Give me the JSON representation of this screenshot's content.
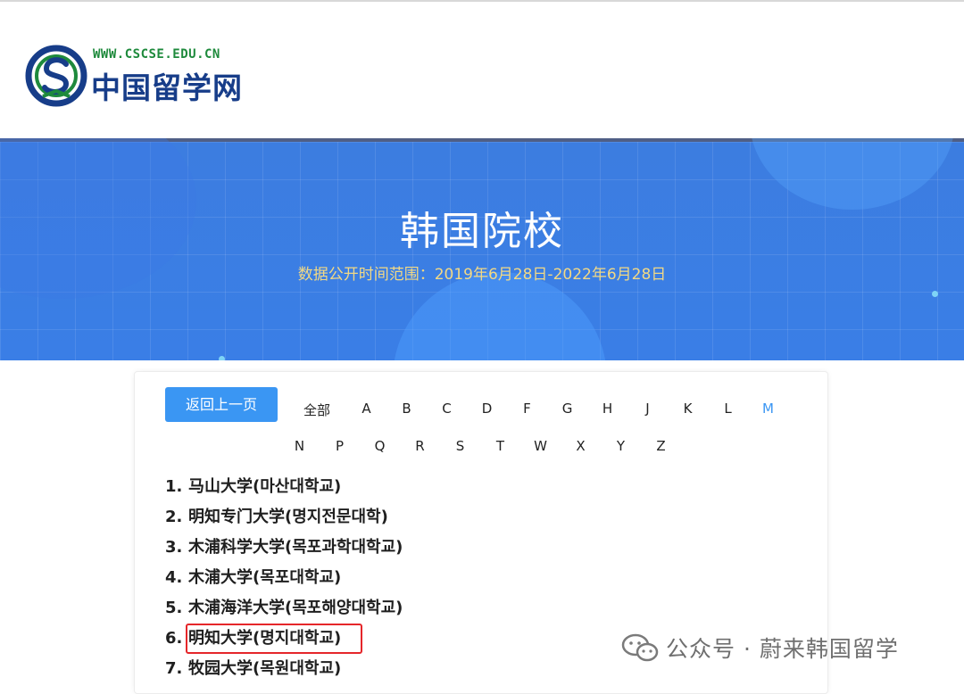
{
  "header": {
    "logo_url": "WWW.CSCSE.EDU.CN",
    "logo_name": "中国留学网"
  },
  "banner": {
    "title": "韩国院校",
    "subtitle": "数据公开时间范围：2019年6月28日-2022年6月28日"
  },
  "nav": {
    "back_label": "返回上一页",
    "all_label": "全部",
    "letters_row1": [
      "A",
      "B",
      "C",
      "D",
      "F",
      "G",
      "H",
      "J",
      "K",
      "L",
      "M"
    ],
    "letters_row2": [
      "N",
      "P",
      "Q",
      "R",
      "S",
      "T",
      "W",
      "X",
      "Y",
      "Z"
    ],
    "active_letter": "M"
  },
  "universities": [
    {
      "num": "1.",
      "name": "马山大学(마산대학교)"
    },
    {
      "num": "2.",
      "name": "明知专门大学(명지전문대학)"
    },
    {
      "num": "3.",
      "name": "木浦科学大学(목포과학대학교)"
    },
    {
      "num": "4.",
      "name": "木浦大学(목포대학교)"
    },
    {
      "num": "5.",
      "name": "木浦海洋大学(목포해양대학교)"
    },
    {
      "num": "6.",
      "name": "明知大学(명지대학교)"
    },
    {
      "num": "7.",
      "name": "牧园大学(목원대학교)"
    }
  ],
  "watermark": {
    "text": "公众号 · 蔚来韩国留学"
  },
  "colors": {
    "accent": "#3a96f3",
    "banner_blue": "#3a7ee6",
    "subtitle_gold": "#f2d985",
    "highlight_red": "#e5262a",
    "logo_green": "#1e8a3c",
    "logo_navy": "#173d89"
  }
}
